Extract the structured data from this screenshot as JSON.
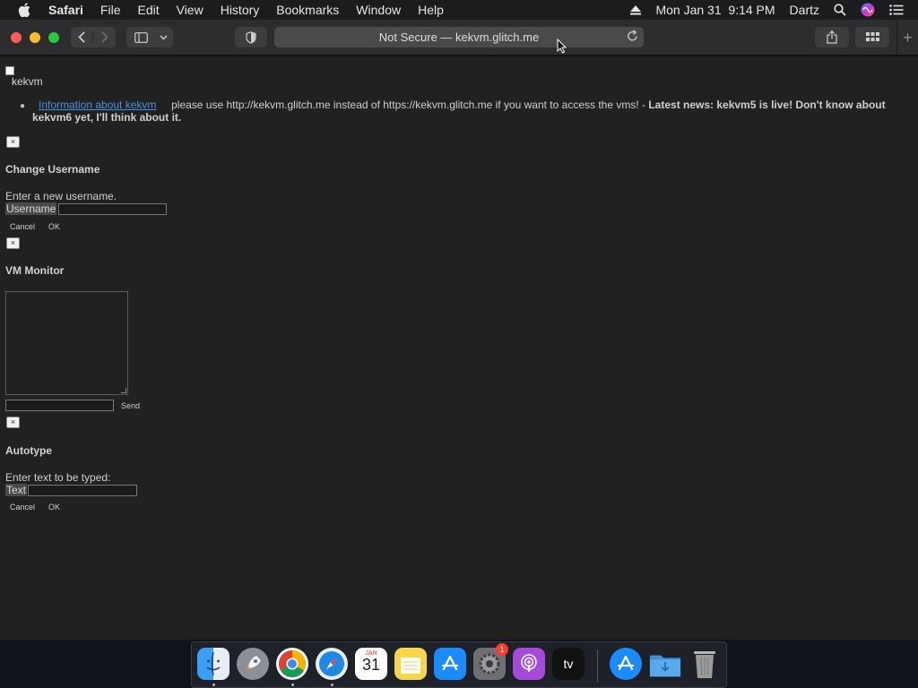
{
  "menubar": {
    "app": "Safari",
    "items": [
      "File",
      "Edit",
      "View",
      "History",
      "Bookmarks",
      "Window",
      "Help"
    ],
    "datetime": "Mon Jan 31  9:14 PM",
    "user": "Dartz"
  },
  "browser": {
    "address": "Not Secure — kekvm.glitch.me"
  },
  "page": {
    "site_name": "kekvm",
    "info_link": "Information about kekvm",
    "notice_plain": "please use http://kekvm.glitch.me instead of https://kekvm.glitch.me if you want to access the vms! - ",
    "notice_bold": "Latest news: kekvm5 is live! Don't know about kekvm6 yet, I'll think about it.",
    "close_symbol": "×",
    "username_dialog": {
      "title": "Change Username",
      "prompt": "Enter a new username.",
      "field_label": "Username",
      "value": "",
      "cancel": "Cancel",
      "ok": "OK"
    },
    "monitor_dialog": {
      "title": "VM Monitor",
      "input_value": "",
      "send": "Send"
    },
    "autotype_dialog": {
      "title": "Autotype",
      "prompt": "Enter text to be typed:",
      "field_label": "Text",
      "value": "",
      "cancel": "Cancel",
      "ok": "OK"
    }
  },
  "dock": {
    "calendar_month": "JAN",
    "calendar_day": "31",
    "settings_badge": "1",
    "tv_label": "tv"
  }
}
